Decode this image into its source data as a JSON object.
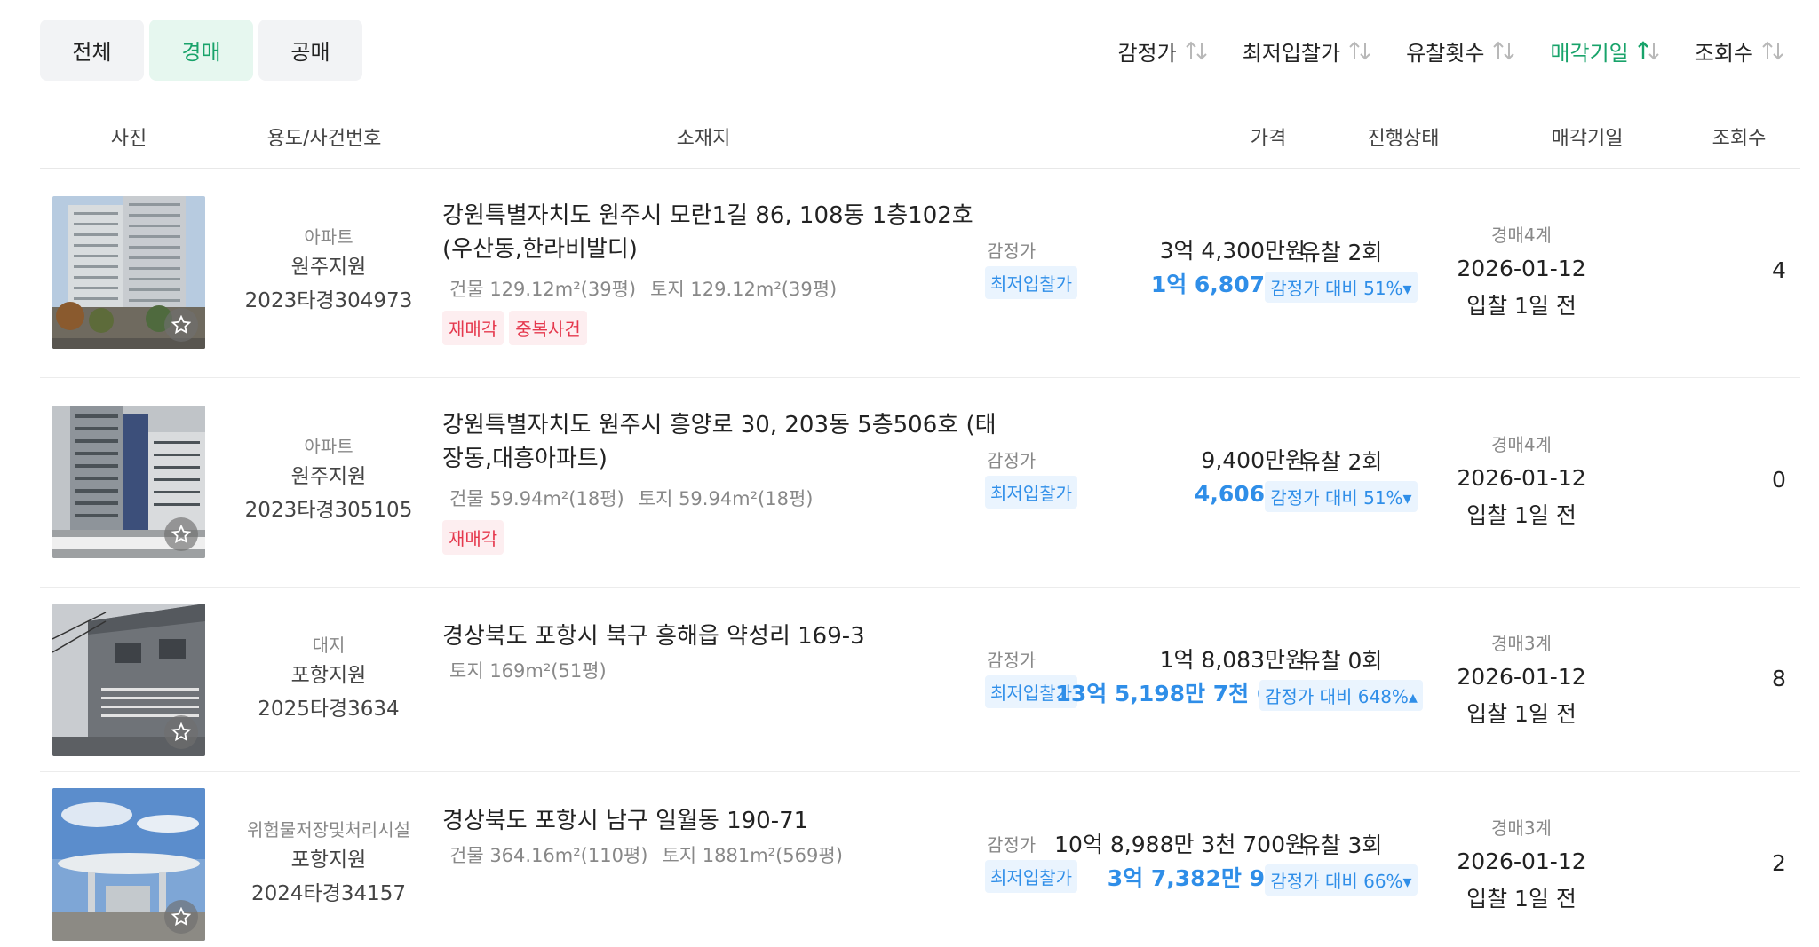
{
  "tabs": [
    {
      "label": "전체",
      "active": false
    },
    {
      "label": "경매",
      "active": true
    },
    {
      "label": "공매",
      "active": false
    }
  ],
  "sorts": [
    {
      "label": "감정가",
      "active": false
    },
    {
      "label": "최저입찰가",
      "active": false
    },
    {
      "label": "유찰횟수",
      "active": false
    },
    {
      "label": "매각기일",
      "active": true
    },
    {
      "label": "조회수",
      "active": false
    }
  ],
  "headers": [
    "사진",
    "용도/사건번호",
    "소재지",
    "가격",
    "진행상태",
    "매각기일",
    "조회수"
  ],
  "labels": {
    "appraisal": "감정가",
    "min_bid": "최저입찰가"
  },
  "rows": [
    {
      "photo": "apartment-building-photo",
      "usage": "아파트",
      "court": "원주지원",
      "case": "2023타경304973",
      "address": "강원특별자치도 원주시 모란1길 86, 108동 1층102호 (우산동,한라비발디)",
      "area_building": "건물 129.12m²(39평)",
      "area_land": "토지 129.12m²(39평)",
      "tags": [
        "재매각",
        "중복사건"
      ],
      "appraisal": "3억 4,300만원",
      "min_bid": "1억 6,807만원",
      "fail_count": "유찰 2회",
      "ratio": "감정가 대비 51%▾",
      "dept": "경매4계",
      "date": "2026-01-12",
      "dday": "입찰 1일 전",
      "views": "4"
    },
    {
      "photo": "apartment-building-photo",
      "usage": "아파트",
      "court": "원주지원",
      "case": "2023타경305105",
      "address": "강원특별자치도 원주시 흥양로 30, 203동 5층506호 (태장동,대흥아파트)",
      "area_building": "건물 59.94m²(18평)",
      "area_land": "토지 59.94m²(18평)",
      "tags": [
        "재매각"
      ],
      "appraisal": "9,400만원",
      "min_bid": "4,606만원",
      "fail_count": "유찰 2회",
      "ratio": "감정가 대비 51%▾",
      "dept": "경매4계",
      "date": "2026-01-12",
      "dday": "입찰 1일 전",
      "views": "0"
    },
    {
      "photo": "street-building-photo",
      "usage": "대지",
      "court": "포항지원",
      "case": "2025타경3634",
      "address": "경상북도 포항시 북구 흥해읍 약성리 169-3",
      "area_building": "",
      "area_land": "토지 169m²(51평)",
      "tags": [],
      "appraisal": "1억 8,083만원",
      "min_bid": "13억 5,198만 7천 600원",
      "fail_count": "유찰 0회",
      "ratio": "감정가 대비 648%▴",
      "dept": "경매3계",
      "date": "2026-01-12",
      "dday": "입찰 1일 전",
      "views": "8"
    },
    {
      "photo": "gas-station-photo",
      "usage": "위험물저장및처리시설",
      "court": "포항지원",
      "case": "2024타경34157",
      "address": "경상북도 포항시 남구 일월동 190-71",
      "area_building": "건물 364.16m²(110평)",
      "area_land": "토지 1881m²(569평)",
      "tags": [],
      "appraisal": "10억 8,988만 3천 700원",
      "min_bid": "3억 7,382만 9천원",
      "fail_count": "유찰 3회",
      "ratio": "감정가 대비 66%▾",
      "dept": "경매3계",
      "date": "2026-01-12",
      "dday": "입찰 1일 전",
      "views": "2"
    }
  ],
  "colors": {
    "accent_green": "#18a36a",
    "accent_blue": "#2f8ee8",
    "tag_red": "#e5384d"
  }
}
